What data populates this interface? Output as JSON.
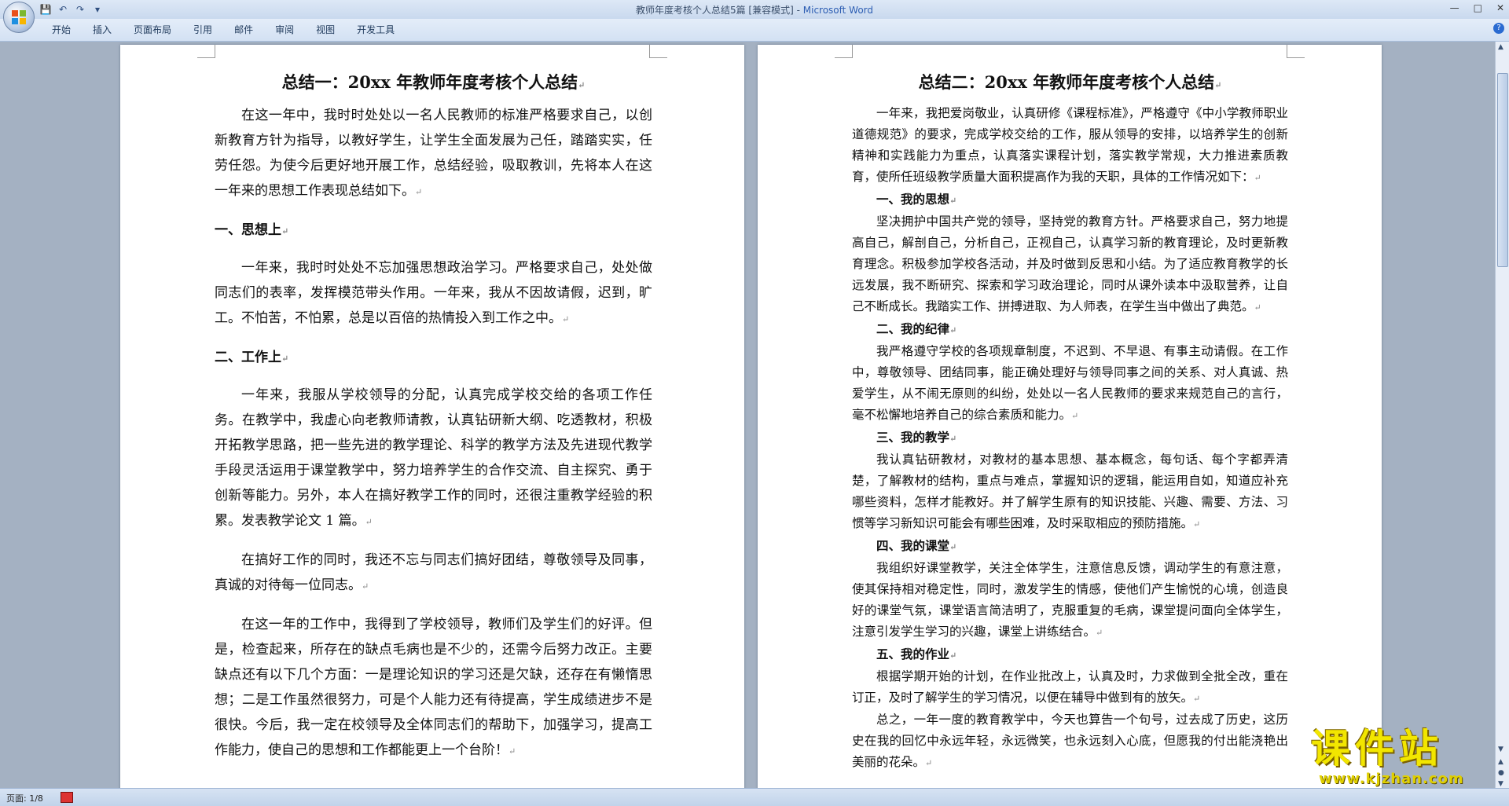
{
  "window": {
    "title": "教师年度考核个人总结5篇 [兼容模式]",
    "app_name": "Microsoft Word",
    "title_sep": " - "
  },
  "ribbon": {
    "tabs": [
      "开始",
      "插入",
      "页面布局",
      "引用",
      "邮件",
      "审阅",
      "视图",
      "开发工具"
    ]
  },
  "left_page": {
    "title": "总结一：20xx 年教师年度考核个人总结",
    "blocks": [
      {
        "type": "p",
        "text": "在这一年中，我时时处处以一名人民教师的标准严格要求自己，以创新教育方针为指导，以教好学生，让学生全面发展为己任，踏踏实实，任劳任怨。为使今后更好地开展工作，总结经验，吸取教训，先将本人在这一年来的思想工作表现总结如下。"
      },
      {
        "type": "h",
        "text": "一、思想上"
      },
      {
        "type": "p",
        "text": "一年来，我时时处处不忘加强思想政治学习。严格要求自己，处处做同志们的表率，发挥模范带头作用。一年来，我从不因故请假，迟到，旷工。不怕苦，不怕累，总是以百倍的热情投入到工作之中。"
      },
      {
        "type": "h",
        "text": "二、工作上"
      },
      {
        "type": "p",
        "text": "一年来，我服从学校领导的分配，认真完成学校交给的各项工作任务。在教学中，我虚心向老教师请教，认真钻研新大纲、吃透教材，积极开拓教学思路，把一些先进的教学理论、科学的教学方法及先进现代教学手段灵活运用于课堂教学中，努力培养学生的合作交流、自主探究、勇于创新等能力。另外，本人在搞好教学工作的同时，还很注重教学经验的积累。发表教学论文 1 篇。"
      },
      {
        "type": "p",
        "text": "在搞好工作的同时，我还不忘与同志们搞好团结，尊敬领导及同事，真诚的对待每一位同志。"
      },
      {
        "type": "p",
        "text": "在这一年的工作中，我得到了学校领导，教师们及学生们的好评。但是，检查起来，所存在的缺点毛病也是不少的，还需今后努力改正。主要缺点还有以下几个方面：一是理论知识的学习还是欠缺，还存在有懒惰思想；二是工作虽然很努力，可是个人能力还有待提高，学生成绩进步不是很快。今后，我一定在校领导及全体同志们的帮助下，加强学习，提高工作能力，使自己的思想和工作都能更上一个台阶！"
      }
    ]
  },
  "right_page": {
    "title": "总结二：20xx 年教师年度考核个人总结",
    "blocks": [
      {
        "type": "p",
        "text": "一年来，我把爱岗敬业，认真研修《课程标准》，严格遵守《中小学教师职业道德规范》的要求，完成学校交给的工作，服从领导的安排，以培养学生的创新精神和实践能力为重点，认真落实课程计划，落实教学常规，大力推进素质教育，使所任班级教学质量大面积提高作为我的天职，具体的工作情况如下："
      },
      {
        "type": "h",
        "text": "一、我的思想"
      },
      {
        "type": "p",
        "text": "坚决拥护中国共产党的领导，坚持党的教育方针。严格要求自己，努力地提高自己，解剖自己，分析自己，正视自己，认真学习新的教育理论，及时更新教育理念。积极参加学校各活动，并及时做到反思和小结。为了适应教育教学的长远发展，我不断研究、探索和学习政治理论，同时从课外读本中汲取营养，让自己不断成长。我踏实工作、拼搏进取、为人师表，在学生当中做出了典范。"
      },
      {
        "type": "h",
        "text": "二、我的纪律"
      },
      {
        "type": "p",
        "text": "我严格遵守学校的各项规章制度，不迟到、不早退、有事主动请假。在工作中，尊敬领导、团结同事，能正确处理好与领导同事之间的关系、对人真诚、热爱学生，从不闹无原则的纠纷，处处以一名人民教师的要求来规范自己的言行，毫不松懈地培养自己的综合素质和能力。"
      },
      {
        "type": "h",
        "text": "三、我的教学"
      },
      {
        "type": "p",
        "text": "我认真钻研教材，对教材的基本思想、基本概念，每句话、每个字都弄清楚，了解教材的结构，重点与难点，掌握知识的逻辑，能运用自如，知道应补充哪些资料，怎样才能教好。并了解学生原有的知识技能、兴趣、需要、方法、习惯等学习新知识可能会有哪些困难，及时采取相应的预防措施。"
      },
      {
        "type": "h",
        "text": "四、我的课堂"
      },
      {
        "type": "p",
        "text": "我组织好课堂教学，关注全体学生，注意信息反馈，调动学生的有意注意，使其保持相对稳定性，同时，激发学生的情感，使他们产生愉悦的心境，创造良好的课堂气氛，课堂语言简洁明了，克服重复的毛病，课堂提问面向全体学生，注意引发学生学习的兴趣，课堂上讲练结合。"
      },
      {
        "type": "h",
        "text": "五、我的作业"
      },
      {
        "type": "p",
        "text": "根据学期开始的计划，在作业批改上，认真及时，力求做到全批全改，重在订正，及时了解学生的学习情况，以便在辅导中做到有的放矢。"
      },
      {
        "type": "p",
        "text": "总之，一年一度的教育教学中，今天也算告一个句号，过去成了历史，这历史在我的回忆中永远年轻，永远微笑，也永远刻入心底，但愿我的付出能浇艳出美丽的花朵。"
      }
    ]
  },
  "status_bar": {
    "page_info": "页面: 1/8"
  },
  "watermark": {
    "big": "课件站",
    "small": "www.kjzhan.com"
  },
  "paragraph_mark": "↵"
}
